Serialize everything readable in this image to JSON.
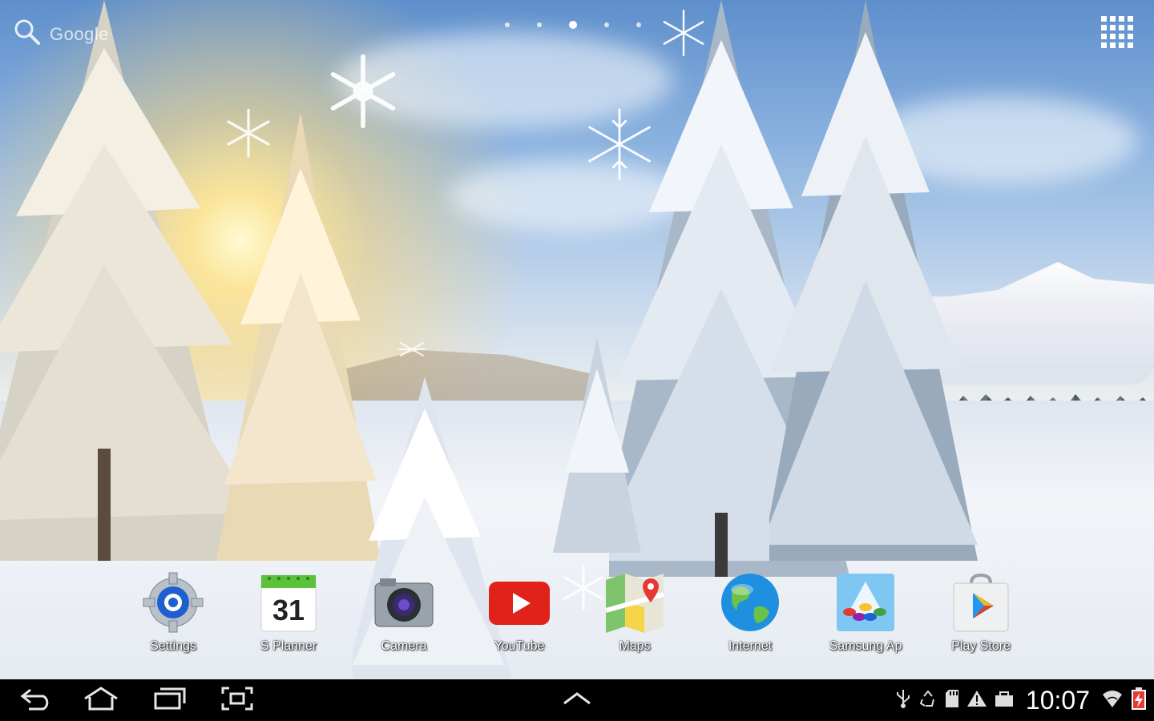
{
  "search_widget": {
    "label": "Google",
    "icon": "search-icon"
  },
  "pager": {
    "count": 5,
    "active_index": 2
  },
  "apps_button": {
    "icon": "app-grid-icon"
  },
  "dock": {
    "apps": [
      {
        "label": "Settings",
        "icon": "settings-gear-icon"
      },
      {
        "label": "S Planner",
        "icon": "calendar-icon",
        "badge": "31"
      },
      {
        "label": "Camera",
        "icon": "camera-icon"
      },
      {
        "label": "YouTube",
        "icon": "youtube-play-icon"
      },
      {
        "label": "Maps",
        "icon": "maps-icon"
      },
      {
        "label": "Internet",
        "icon": "globe-icon"
      },
      {
        "label": "Samsung Ap",
        "icon": "samsung-apps-icon"
      },
      {
        "label": "Play Store",
        "icon": "play-store-icon"
      }
    ]
  },
  "navbar": {
    "buttons": [
      "back-icon",
      "home-icon",
      "recents-icon",
      "screenshot-icon"
    ],
    "center": "chevron-up-icon"
  },
  "status_bar": {
    "icons": [
      "usb-icon",
      "recycle-icon",
      "sd-card-icon",
      "warning-icon",
      "bag-icon"
    ],
    "time": "10:07",
    "wifi": "wifi-icon",
    "battery": "battery-charging-icon",
    "battery_color": "#e53935"
  }
}
